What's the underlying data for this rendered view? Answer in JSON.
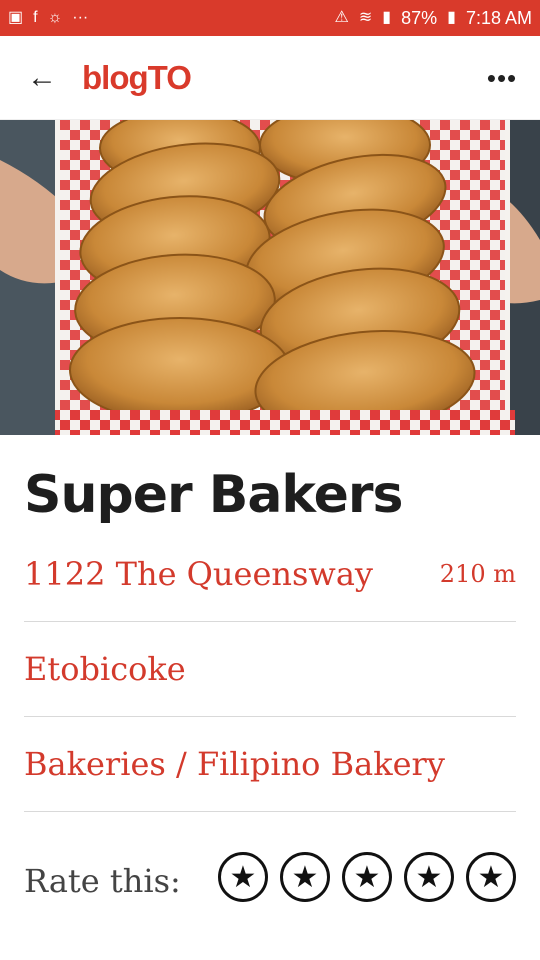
{
  "status_bar": {
    "battery": "87%",
    "time": "7:18 AM"
  },
  "app_bar": {
    "logo": "blogTO"
  },
  "place": {
    "name": "Super Bakers",
    "address": "1122 The Queensway",
    "distance": "210 m",
    "neighborhood": "Etobicoke",
    "category": "Bakeries / Filipino Bakery"
  },
  "rating": {
    "label": "Rate this:",
    "stars": [
      "★",
      "★",
      "★",
      "★",
      "★"
    ]
  },
  "colors": {
    "brand": "#d93a2b",
    "link": "#d33a2c"
  }
}
